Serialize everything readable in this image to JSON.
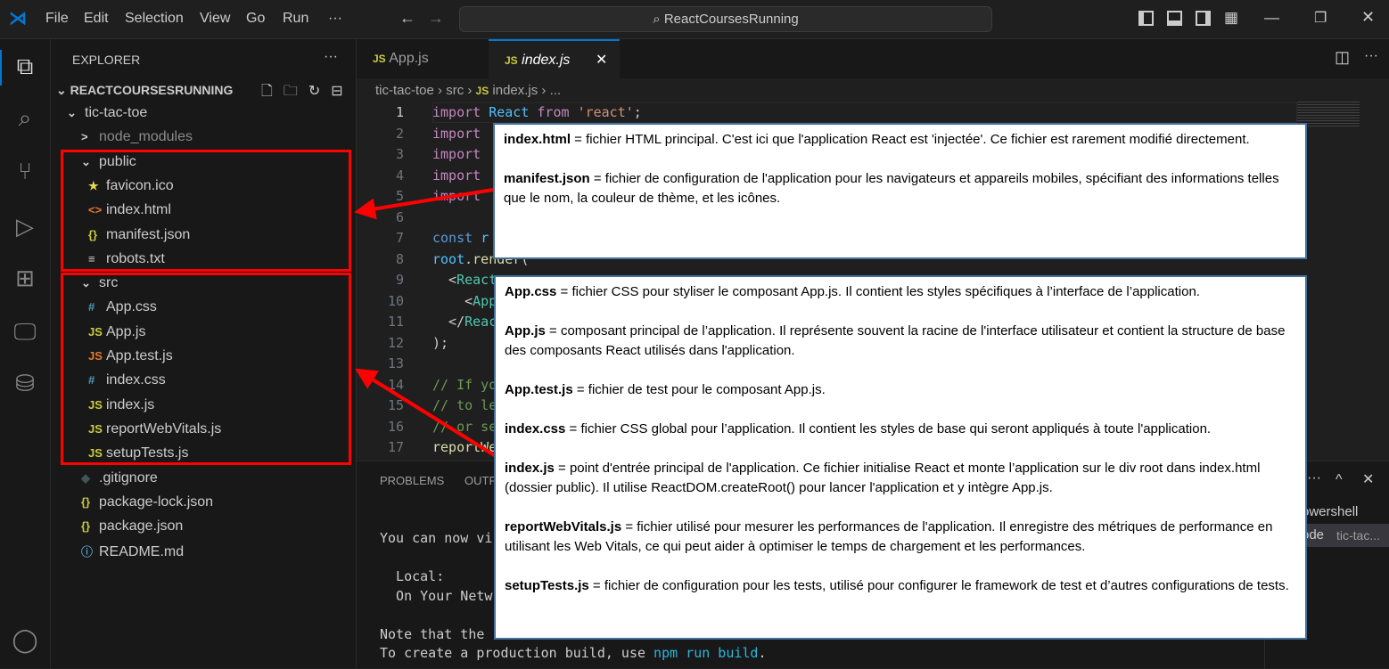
{
  "titlebar": {
    "menu": [
      "File",
      "Edit",
      "Selection",
      "View",
      "Go",
      "Run",
      "···"
    ],
    "search": "ReactCoursesRunning",
    "accent": "#0078d4"
  },
  "activity": {
    "icons": [
      "files-icon",
      "search-icon",
      "source-control-icon",
      "run-debug-icon",
      "extensions-icon",
      "remote-explorer-icon",
      "database-icon",
      "account-icon"
    ]
  },
  "sidebar": {
    "title": "EXPLORER",
    "more": "···",
    "root": "REACTCOURSESRUNNING",
    "items": [
      {
        "label": "tic-tac-toe",
        "kind": "folder-open",
        "icon": "⌄"
      },
      {
        "label": "node_modules",
        "kind": "folder",
        "icon": ">"
      },
      {
        "label": "public",
        "kind": "folder-open",
        "icon": "⌄"
      },
      {
        "label": "favicon.ico",
        "kind": "star",
        "icon": "★"
      },
      {
        "label": "index.html",
        "kind": "html",
        "icon": "<>"
      },
      {
        "label": "manifest.json",
        "kind": "json",
        "icon": "{}"
      },
      {
        "label": "robots.txt",
        "kind": "text",
        "icon": "≡"
      },
      {
        "label": "src",
        "kind": "folder-open",
        "icon": "⌄"
      },
      {
        "label": "App.css",
        "kind": "css",
        "icon": "#"
      },
      {
        "label": "App.js",
        "kind": "js",
        "icon": "JS"
      },
      {
        "label": "App.test.js",
        "kind": "test",
        "icon": "JS"
      },
      {
        "label": "index.css",
        "kind": "css",
        "icon": "#"
      },
      {
        "label": "index.js",
        "kind": "js",
        "icon": "JS"
      },
      {
        "label": "reportWebVitals.js",
        "kind": "js",
        "icon": "JS"
      },
      {
        "label": "setupTests.js",
        "kind": "js",
        "icon": "JS"
      },
      {
        "label": ".gitignore",
        "kind": "git",
        "icon": "◆"
      },
      {
        "label": "package-lock.json",
        "kind": "json",
        "icon": "{}"
      },
      {
        "label": "package.json",
        "kind": "json",
        "icon": "{}"
      },
      {
        "label": "README.md",
        "kind": "info",
        "icon": "ⓘ"
      }
    ]
  },
  "editor": {
    "tabs": [
      {
        "label": "App.js",
        "icon": "JS"
      },
      {
        "label": "index.js",
        "icon": "JS",
        "active": true,
        "close": "✕"
      }
    ],
    "breadcrumb": [
      "tic-tac-toe",
      "src",
      "index.js",
      "..."
    ],
    "line_numbers": [
      "1",
      "2",
      "3",
      "4",
      "5",
      "6",
      "7",
      "8",
      "9",
      "10",
      "11",
      "12",
      "13",
      "14",
      "15",
      "16",
      "17"
    ],
    "lines": [
      [
        [
          "kw",
          "import "
        ],
        [
          "var",
          "React "
        ],
        [
          "kw",
          "from "
        ],
        [
          "str",
          "'react'"
        ],
        [
          "",
          "; "
        ]
      ],
      [
        [
          "kw",
          "import"
        ]
      ],
      [
        [
          "kw",
          "import"
        ]
      ],
      [
        [
          "kw",
          "import"
        ]
      ],
      [
        [
          "kw",
          "import"
        ]
      ],
      [],
      [
        [
          "dec",
          "const "
        ],
        [
          "var",
          "r"
        ]
      ],
      [
        [
          "var",
          "root"
        ],
        [
          "",
          "."
        ],
        [
          "fn",
          "render"
        ],
        [
          "",
          "("
        ]
      ],
      [
        [
          "",
          "  <"
        ],
        [
          "tg",
          "React"
        ]
      ],
      [
        [
          "",
          "    <"
        ],
        [
          "tg",
          "App"
        ]
      ],
      [
        [
          "",
          "  </"
        ],
        [
          "tg",
          "Reac"
        ]
      ],
      [
        [
          "",
          ");"
        ]
      ],
      [],
      [
        [
          "cm",
          "// If yo"
        ]
      ],
      [
        [
          "cm",
          "// to le"
        ]
      ],
      [
        [
          "cm",
          "// or se"
        ]
      ],
      [
        [
          "fn",
          "reportWe"
        ]
      ]
    ]
  },
  "panel": {
    "tabs": [
      "PROBLEMS",
      "OUTP"
    ],
    "actions": [
      "···",
      "^",
      "✕"
    ],
    "terminal": [
      {
        "text": "You can now vi"
      },
      {
        "text": ""
      },
      {
        "text": "  Local:"
      },
      {
        "text": "  On Your Netw"
      },
      {
        "text": ""
      },
      {
        "text": "Note that the "
      },
      {
        "text": "To create a production build, use ",
        "link": "npm run build",
        "end": "."
      }
    ],
    "terminals": [
      {
        "label": "owershell"
      },
      {
        "label": "ode",
        "sub": "tic-tac..."
      }
    ]
  },
  "notes": {
    "box1": [
      {
        "term": "index.html",
        "text": " =  fichier HTML principal. C'est ici que l'application React est 'injectée'. Ce fichier est rarement modifié directement."
      },
      {
        "term": "manifest.json",
        "text": " = fichier de configuration de l'application pour les navigateurs et appareils mobiles, spécifiant des informations telles que le nom, la couleur de thème, et les icônes."
      }
    ],
    "box2": [
      {
        "term": "App.css",
        "text": " = fichier CSS pour styliser le composant App.js. Il contient les styles spécifiques à l’interface de l’application."
      },
      {
        "term": "App.js",
        "text": " = composant principal de l’application. Il représente souvent la racine de l'interface utilisateur et contient la structure de base des composants React utilisés dans l'application."
      },
      {
        "term": "App.test.js",
        "text": " = fichier de test pour le composant App.js."
      },
      {
        "term": "index.css",
        "text": " = fichier CSS global pour l’application. Il contient les styles de base qui seront appliqués à toute l'application."
      },
      {
        "term": "index.js",
        "text": " = point d'entrée principal de l'application. Ce fichier initialise React et monte l’application sur le div root dans index.html (dossier public). Il utilise ReactDOM.createRoot() pour lancer l'application et y intègre App.js."
      },
      {
        "term": "reportWebVitals.js",
        "text": " = fichier utilisé pour mesurer les performances de l'application. Il enregistre des métriques de performance en utilisant les Web Vitals, ce qui peut aider à optimiser le temps de chargement et les performances."
      },
      {
        "term": "setupTests.js",
        "text": " = fichier de configuration pour les tests, utilisé pour configurer le framework de test  et d’autres configurations de tests."
      }
    ],
    "highlight_color": "#ff0000"
  }
}
